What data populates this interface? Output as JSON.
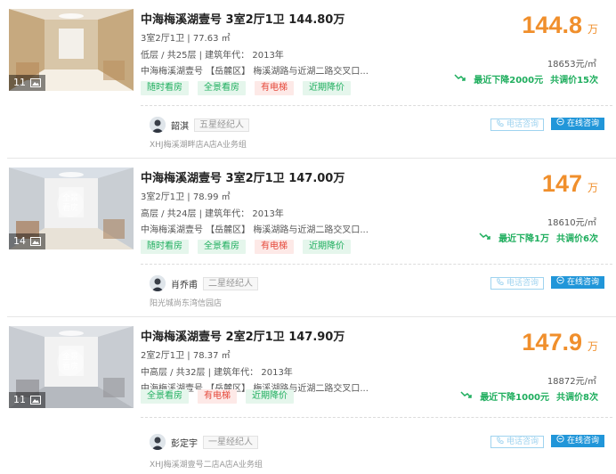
{
  "listings": [
    {
      "photo_count": "11",
      "vr_label": "",
      "title": "中海梅溪湖壹号 3室2厅1卫 144.80万",
      "layout": "3室2厅1卫",
      "area": "77.63 ㎡",
      "floor_info": "低层 / 共25层 | 建筑年代： 2013年",
      "address": "中海梅溪湖壹号 【岳麓区】 梅溪湖路与近湖二路交叉口...",
      "tags": [
        {
          "label": "随时看房",
          "color": "green"
        },
        {
          "label": "全景看房",
          "color": "green"
        },
        {
          "label": "有电梯",
          "color": "red"
        },
        {
          "label": "近期降价",
          "color": "green"
        }
      ],
      "price": "144.8",
      "price_unit": "万",
      "unit_price": "18653元/㎡",
      "drop_text": "最近下降2000元",
      "adjust_text": "共调价15次",
      "agent_name": "韶淇",
      "agent_rank": "五星经纪人",
      "store": "XHJ梅溪湖畔店A店A业务组",
      "phone_label": "电话咨询",
      "chat_label": "在线咨询"
    },
    {
      "photo_count": "14",
      "vr_label": "全景\n看房",
      "title": "中海梅溪湖壹号 3室2厅1卫 147.00万",
      "layout": "3室2厅1卫",
      "area": "78.99 ㎡",
      "floor_info": "高层 / 共24层 | 建筑年代： 2013年",
      "address": "中海梅溪湖壹号 【岳麓区】 梅溪湖路与近湖二路交叉口...",
      "tags": [
        {
          "label": "随时看房",
          "color": "green"
        },
        {
          "label": "全景看房",
          "color": "green"
        },
        {
          "label": "有电梯",
          "color": "red"
        },
        {
          "label": "近期降价",
          "color": "green"
        }
      ],
      "price": "147",
      "price_unit": "万",
      "unit_price": "18610元/㎡",
      "drop_text": "最近下降1万",
      "adjust_text": "共调价6次",
      "agent_name": "肖乔甫",
      "agent_rank": "二星经纪人",
      "store": "阳光城尚东湾信园店",
      "phone_label": "电话咨询",
      "chat_label": "在线咨询"
    },
    {
      "photo_count": "11",
      "vr_label": "全景\n看房",
      "title": "中海梅溪湖壹号 2室2厅1卫 147.90万",
      "layout": "2室2厅1卫",
      "area": "78.37 ㎡",
      "floor_info": "中高层 / 共32层 | 建筑年代： 2013年",
      "address": "中海梅溪湖壹号 【岳麓区】 梅溪湖路与近湖二路交叉口...",
      "tags": [
        {
          "label": "全景看房",
          "color": "green"
        },
        {
          "label": "有电梯",
          "color": "red"
        },
        {
          "label": "近期降价",
          "color": "green"
        }
      ],
      "price": "147.9",
      "price_unit": "万",
      "unit_price": "18872元/㎡",
      "drop_text": "最近下降1000元",
      "adjust_text": "共调价8次",
      "agent_name": "彭定宇",
      "agent_rank": "一星经纪人",
      "store": "XHJ梅溪湖壹号二店A店A业务组",
      "phone_label": "电话咨询",
      "chat_label": "在线咨询"
    }
  ]
}
